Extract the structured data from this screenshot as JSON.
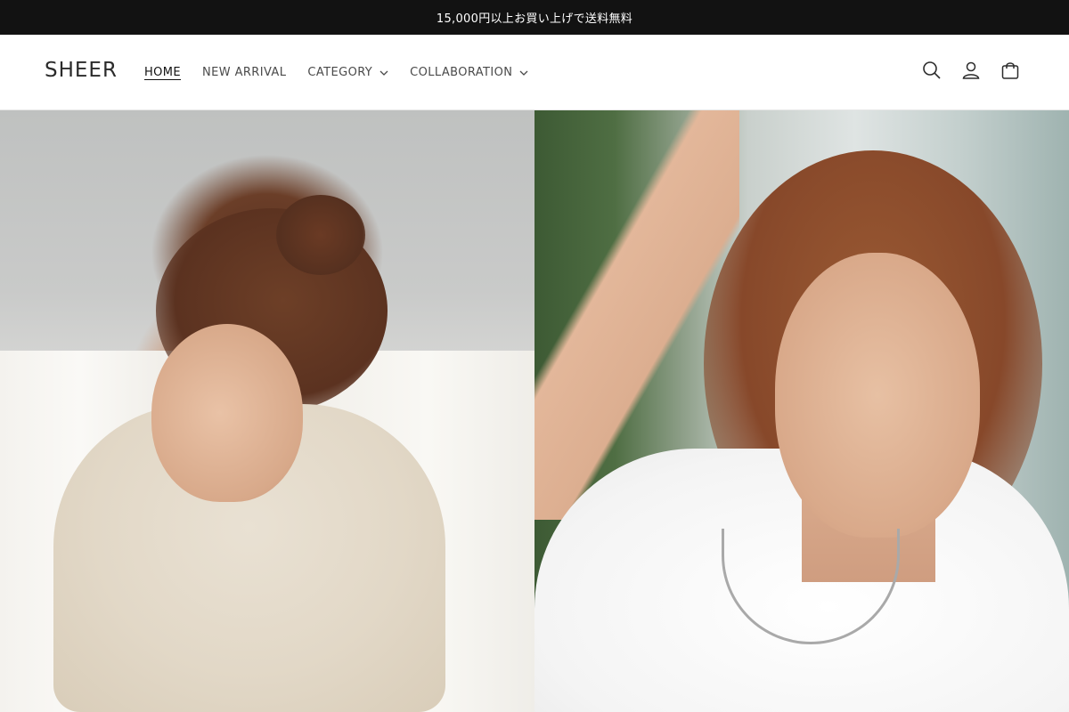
{
  "announcement": {
    "text": "15,000円以上お買い上げで送料無料"
  },
  "header": {
    "logo": "SHEER",
    "nav": [
      {
        "label": "HOME",
        "active": true,
        "has_dropdown": false
      },
      {
        "label": "NEW ARRIVAL",
        "active": false,
        "has_dropdown": false
      },
      {
        "label": "CATEGORY",
        "active": false,
        "has_dropdown": true
      },
      {
        "label": "COLLABORATION",
        "active": false,
        "has_dropdown": true
      }
    ],
    "icons": [
      "search-icon",
      "account-icon",
      "cart-icon"
    ]
  },
  "hero": {
    "images": [
      {
        "name": "hero-image-left",
        "icon": "photo"
      },
      {
        "name": "hero-image-right",
        "icon": "photo"
      }
    ]
  },
  "colors": {
    "announcement_bg": "#121212",
    "announcement_text": "#ffffff",
    "header_bg": "#ffffff",
    "text": "#121212"
  }
}
